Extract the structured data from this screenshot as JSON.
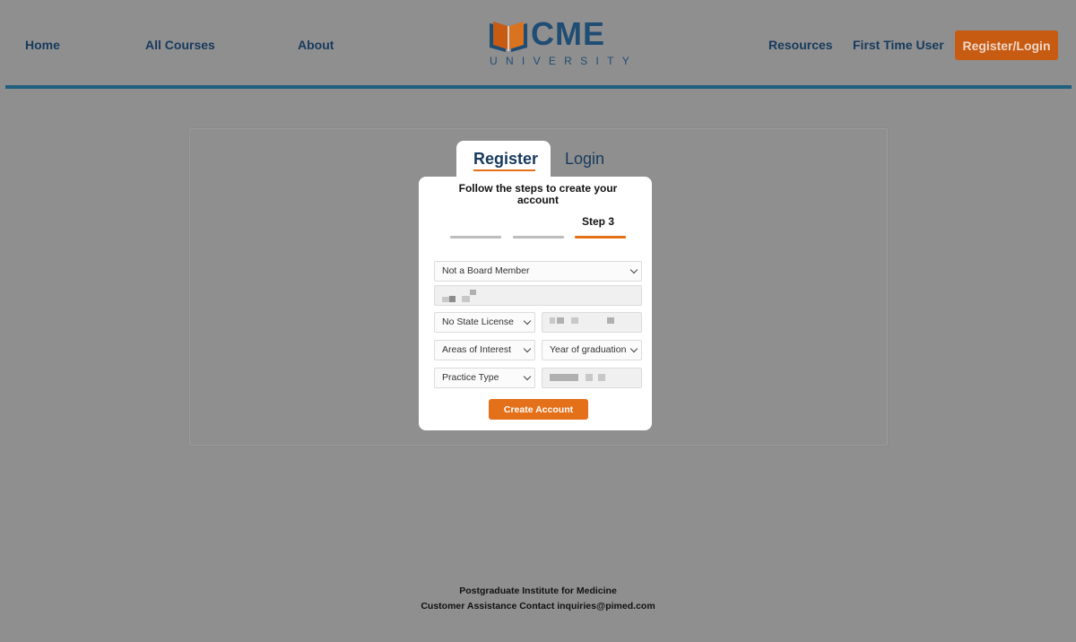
{
  "nav": {
    "home": "Home",
    "all_courses": "All Courses",
    "about": "About",
    "resources": "Resources",
    "first_time_user": "First Time User",
    "register_login": "Register/Login"
  },
  "logo": {
    "name": "CME",
    "subtitle": "UNIVERSITY"
  },
  "tabs": {
    "register": "Register",
    "login": "Login"
  },
  "form": {
    "heading": "Follow the steps to create your account",
    "step_label": "Step 3",
    "current_step": 3,
    "total_steps": 3,
    "board_member_select": "Not a Board Member",
    "state_license_select": "No State License",
    "areas_of_interest_select": "Areas of Interest",
    "year_of_graduation_select": "Year of graduation",
    "practice_type_select": "Practice Type",
    "create_account_button": "Create Account"
  },
  "colors": {
    "overlay": "#8f8f8f",
    "brand_navy": "#173a5e",
    "accent_orange": "#e5701a",
    "header_rule": "#1f5f80"
  },
  "footer": {
    "institute": "Postgraduate Institute for Medicine",
    "contact": "Customer Assistance Contact inquiries@pimed.com"
  }
}
